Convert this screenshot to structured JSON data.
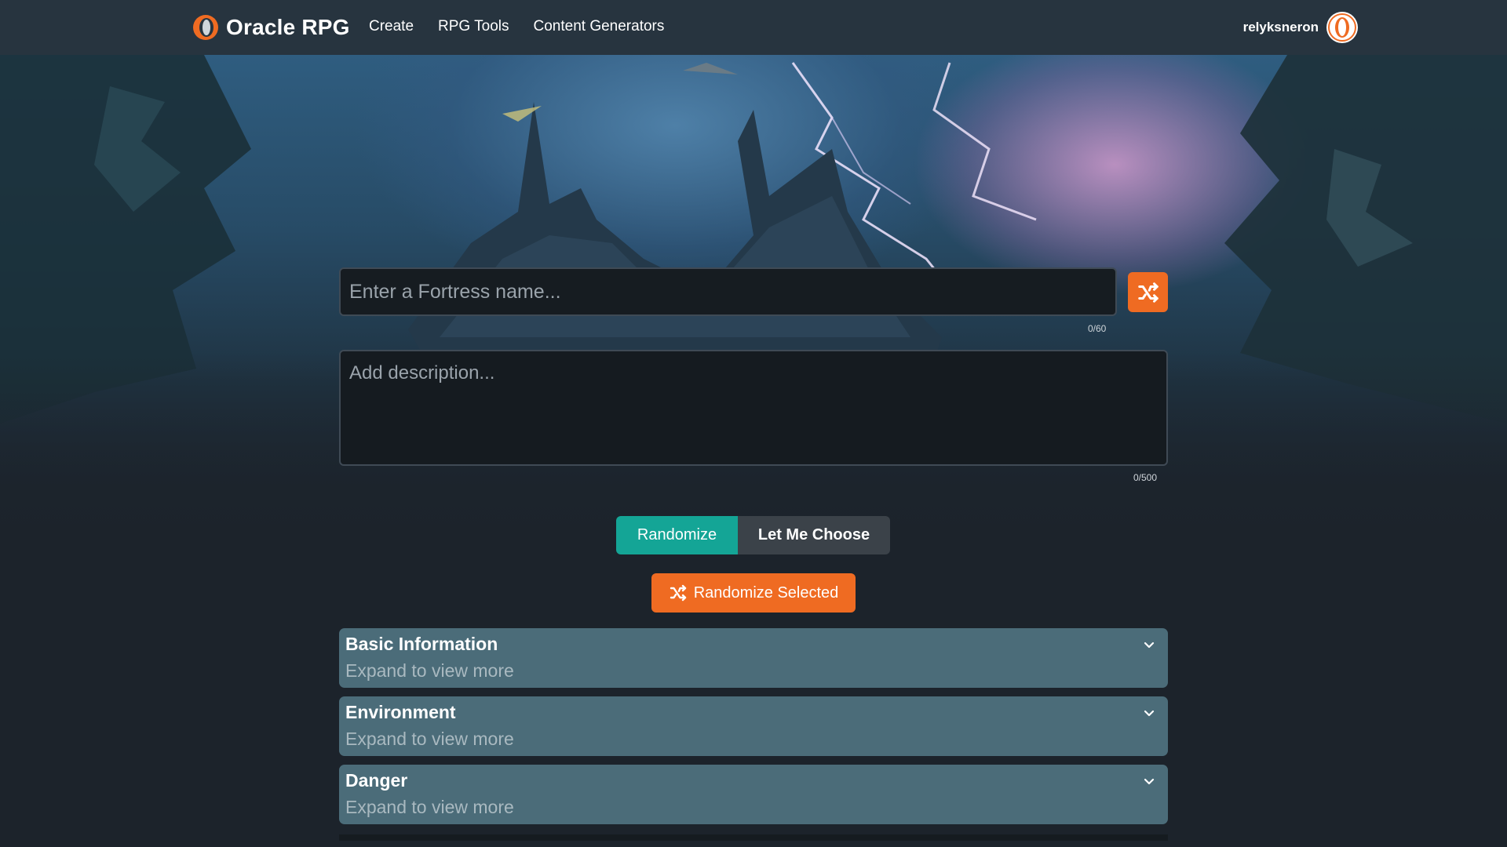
{
  "header": {
    "brand": "Oracle RPG",
    "nav": [
      "Create",
      "RPG Tools",
      "Content Generators"
    ],
    "username": "relyksneron"
  },
  "form": {
    "name_placeholder": "Enter a Fortress name...",
    "name_counter": "0/60",
    "description_placeholder": "Add description...",
    "description_counter": "0/500"
  },
  "mode": {
    "randomize_label": "Randomize",
    "choose_label": "Let Me Choose"
  },
  "randomize_selected_label": "Randomize Selected",
  "sections": [
    {
      "title": "Basic Information",
      "subtitle": "Expand to view more"
    },
    {
      "title": "Environment",
      "subtitle": "Expand to view more"
    },
    {
      "title": "Danger",
      "subtitle": "Expand to view more"
    }
  ],
  "colors": {
    "header_bg": "#27343f",
    "accent_orange": "#ef6b22",
    "accent_teal": "#14a596",
    "section_bg": "#4b6c79"
  },
  "icons": {
    "brand": "oracle-logo-icon",
    "shuffle": "shuffle-icon",
    "avatar": "avatar-icon",
    "chevron": "chevron-down-icon"
  }
}
